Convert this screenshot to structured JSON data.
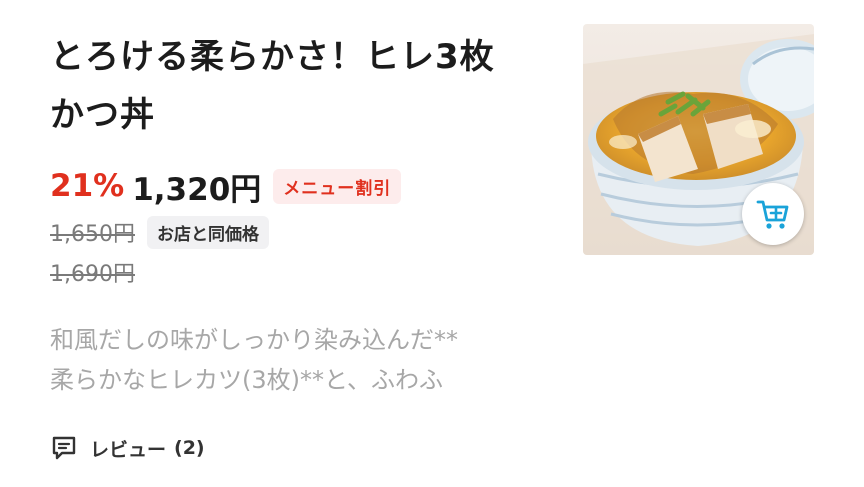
{
  "product": {
    "title_line1": "とろける柔らかさ！ヒレ3枚",
    "title_line2": "かつ丼",
    "discount": "21%",
    "price": "1,320円",
    "promo_badge": "メニュー割引",
    "original_price": "1,650円",
    "same_price_badge": "お店と同価格",
    "store_price": "1,690円",
    "description_line1": "和風だしの味がしっかり染み込んだ**",
    "description_line2": "柔らかなヒレカツ(3枚)**と、ふわふ",
    "review_label": "レビュー",
    "review_count": "(2)"
  },
  "colors": {
    "accent_red": "#e0301e",
    "cart_blue": "#1aa3d9",
    "muted_text": "#a7a7a7"
  },
  "icons": {
    "review": "speech-bubble-icon",
    "cart": "add-to-cart-icon",
    "image": "katsudon-bowl-photo"
  }
}
